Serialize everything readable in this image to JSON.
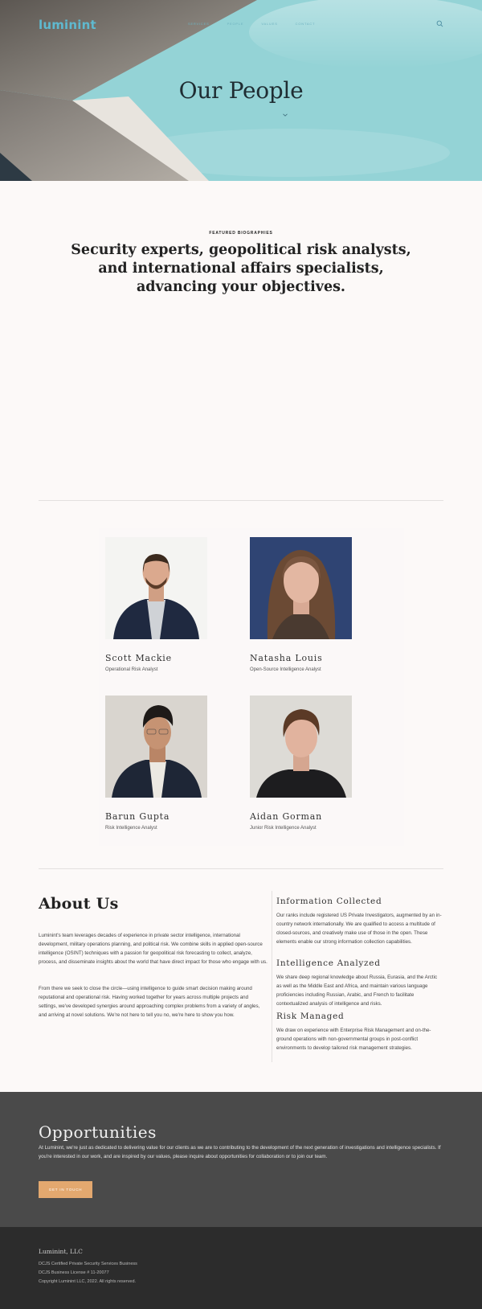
{
  "nav": {
    "logo": "luminint",
    "items": [
      {
        "label": "Services"
      },
      {
        "label": "People"
      },
      {
        "label": "Values"
      },
      {
        "label": "Contact"
      }
    ]
  },
  "hero": {
    "title": "Our People"
  },
  "featured": {
    "eyebrow": "FEATURED BIOGRAPHIES",
    "lead": "Security experts, geopolitical risk analysts, and international affairs specialists, advancing your objectives."
  },
  "team": [
    {
      "name": "Scott Mackie",
      "role": "Operational Risk Analyst"
    },
    {
      "name": "Natasha Louis",
      "role": "Open-Source Intelligence Analyst"
    },
    {
      "name": "Barun Gupta",
      "role": "Risk Intelligence Analyst"
    },
    {
      "name": "Aidan Gorman",
      "role": "Junior Risk Intelligence Analyst"
    }
  ],
  "about": {
    "title": "About Us",
    "p1": "Luminint's team leverages decades of experience in private sector intelligence, international development, military operations planning, and political risk. We combine skills in applied open-source intelligence (OSINT) techniques with a passion for geopolitical risk forecasting to collect, analyze, process, and disseminate insights about the world that have direct impact for those who engage with us.",
    "p2": "From there we seek to close the circle—using intelligence to guide smart decision making around reputational and operational risk. Having worked together for years across multiple projects and settings, we've developed synergies around approaching complex problems from a variety of angles, and arriving at novel solutions. We're not here to tell you no, we're here to show you how."
  },
  "features": [
    {
      "title": "Information Collected",
      "text": "Our ranks include registered US Private Investigators, augmented by an in-country network internationally. We are qualified to access a multitude of closed-sources, and creatively make use of those in the open. These elements enable our strong information collection capabilities."
    },
    {
      "title": "Intelligence Analyzed",
      "text": "We share deep regional knowledge about Russia, Eurasia, and the Arctic as well as the Middle East and Africa, and maintain various language proficiencies including Russian, Arabic, and French to facilitate contextualized analysis of intelligence and risks."
    },
    {
      "title": "Risk Managed",
      "text": "We draw on experience with Enterprise Risk Management and on-the-ground operations with non-governmental groups in post-conflict environments to develop tailored risk management strategies."
    }
  ],
  "opportunities": {
    "title": "Opportunities",
    "text": "At Luminint, we're just as dedicated to delivering value for our clients as we are to contributing to the development of the next generation of investigations and intelligence specialists. If you're interested in our work, and are inspired by our values, please inquire about opportunities for collaboration or to join our team.",
    "cta": "GET IN TOUCH"
  },
  "footer": {
    "brand": "Luminint, LLC",
    "lines": [
      "DCJS Certified Private Security Services Business",
      "DCJS Business License # 11-20077",
      "Copyright Luminint LLC, 2022.  All rights reserved."
    ]
  },
  "colors": {
    "accent": "#e3a86f",
    "logo": "#5fb9cf",
    "sky": "#93d3d5",
    "dark_band": "#4a4a4a",
    "footer": "#2c2c2c"
  }
}
